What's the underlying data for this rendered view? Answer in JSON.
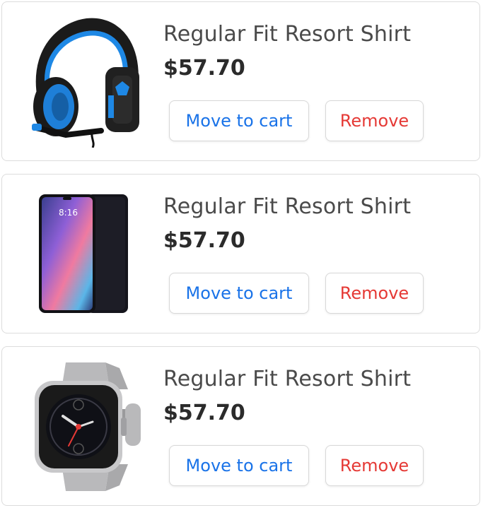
{
  "colors": {
    "move_text": "#1a73e8",
    "remove_text": "#e53935",
    "title_text": "#4a4a4a",
    "price_text": "#2b2b2b",
    "card_border": "#dcdcdc"
  },
  "items": [
    {
      "image": "headset-image",
      "title": "Regular Fit Resort Shirt",
      "price": "$57.70",
      "move_label": "Move to cart",
      "remove_label": "Remove"
    },
    {
      "image": "smartphone-image",
      "title": "Regular Fit Resort Shirt",
      "price": "$57.70",
      "move_label": "Move to cart",
      "remove_label": "Remove"
    },
    {
      "image": "smartwatch-image",
      "title": "Regular Fit Resort Shirt",
      "price": "$57.70",
      "move_label": "Move to cart",
      "remove_label": "Remove"
    }
  ]
}
